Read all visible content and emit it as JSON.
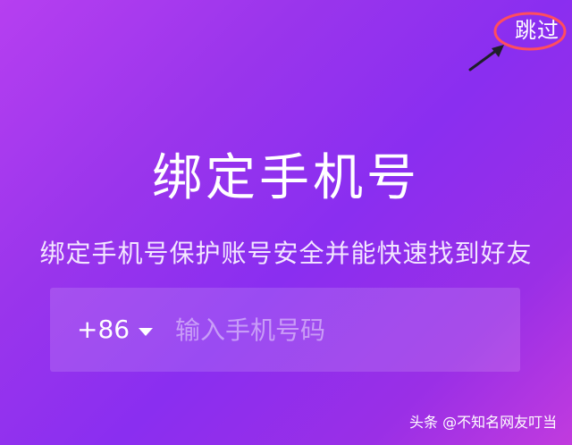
{
  "skip_label": "跳过",
  "title": "绑定手机号",
  "subtitle": "绑定手机号保护账号安全并能快速找到好友",
  "phone_field": {
    "country_code": "+86",
    "placeholder": "输入手机号码",
    "value": ""
  },
  "watermark": "头条 @不知名网友叮当",
  "colors": {
    "gradient_start": "#b63ff0",
    "gradient_mid": "#8a2ef0",
    "gradient_end": "#c13bde",
    "annotation_circle": "#ff4d5e",
    "annotation_arrow": "#1f1f2a"
  },
  "icons": {
    "country_dropdown": "chevron-down-icon"
  }
}
